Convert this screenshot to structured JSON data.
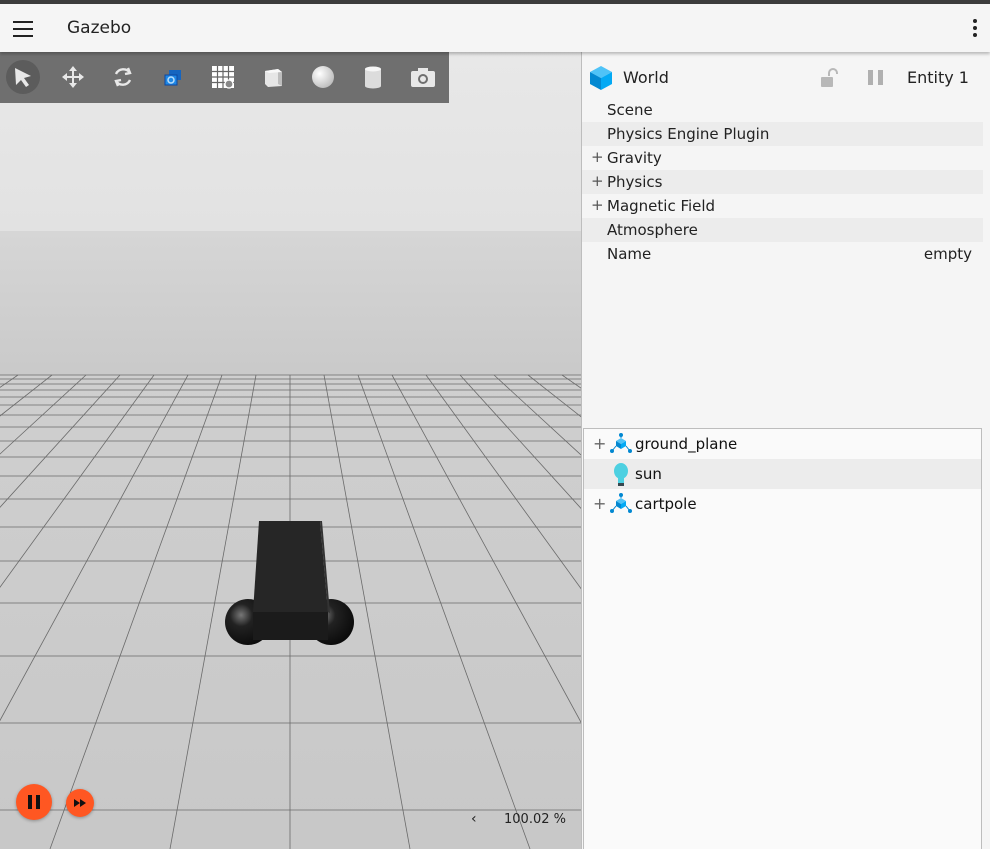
{
  "app": {
    "title": "Gazebo"
  },
  "toolbar": {
    "tools": [
      {
        "icon": "select-arrow-icon",
        "name": "select"
      },
      {
        "icon": "translate-icon",
        "name": "translate"
      },
      {
        "icon": "rotate-icon",
        "name": "rotate"
      },
      {
        "icon": "transform-control-icon",
        "name": "transform-control"
      },
      {
        "icon": "grid-snap-icon",
        "name": "grid"
      },
      {
        "icon": "box-icon",
        "name": "box"
      },
      {
        "icon": "sphere-icon",
        "name": "sphere"
      },
      {
        "icon": "cylinder-icon",
        "name": "cylinder"
      },
      {
        "icon": "camera-icon",
        "name": "screenshot"
      }
    ]
  },
  "playback": {
    "rtf_value": "100.02 %",
    "rtf_arrow": "‹",
    "accent": "#ff5722"
  },
  "inspector": {
    "title": "World",
    "entity": "Entity 1",
    "rows": [
      {
        "label": "Scene",
        "value": "",
        "expandable": false
      },
      {
        "label": "Physics Engine Plugin",
        "value": "",
        "expandable": false
      },
      {
        "label": "Gravity",
        "value": "",
        "expandable": true
      },
      {
        "label": "Physics",
        "value": "",
        "expandable": true
      },
      {
        "label": "Magnetic Field",
        "value": "",
        "expandable": true
      },
      {
        "label": "Atmosphere",
        "value": "",
        "expandable": false
      },
      {
        "label": "Name",
        "value": "empty",
        "expandable": false
      }
    ]
  },
  "entity_tree": {
    "items": [
      {
        "label": "ground_plane",
        "icon": "model-icon",
        "expandable": true
      },
      {
        "label": "sun",
        "icon": "light-bulb-icon",
        "expandable": false
      },
      {
        "label": "cartpole",
        "icon": "model-icon",
        "expandable": true
      }
    ]
  },
  "expand_symbol": "+"
}
